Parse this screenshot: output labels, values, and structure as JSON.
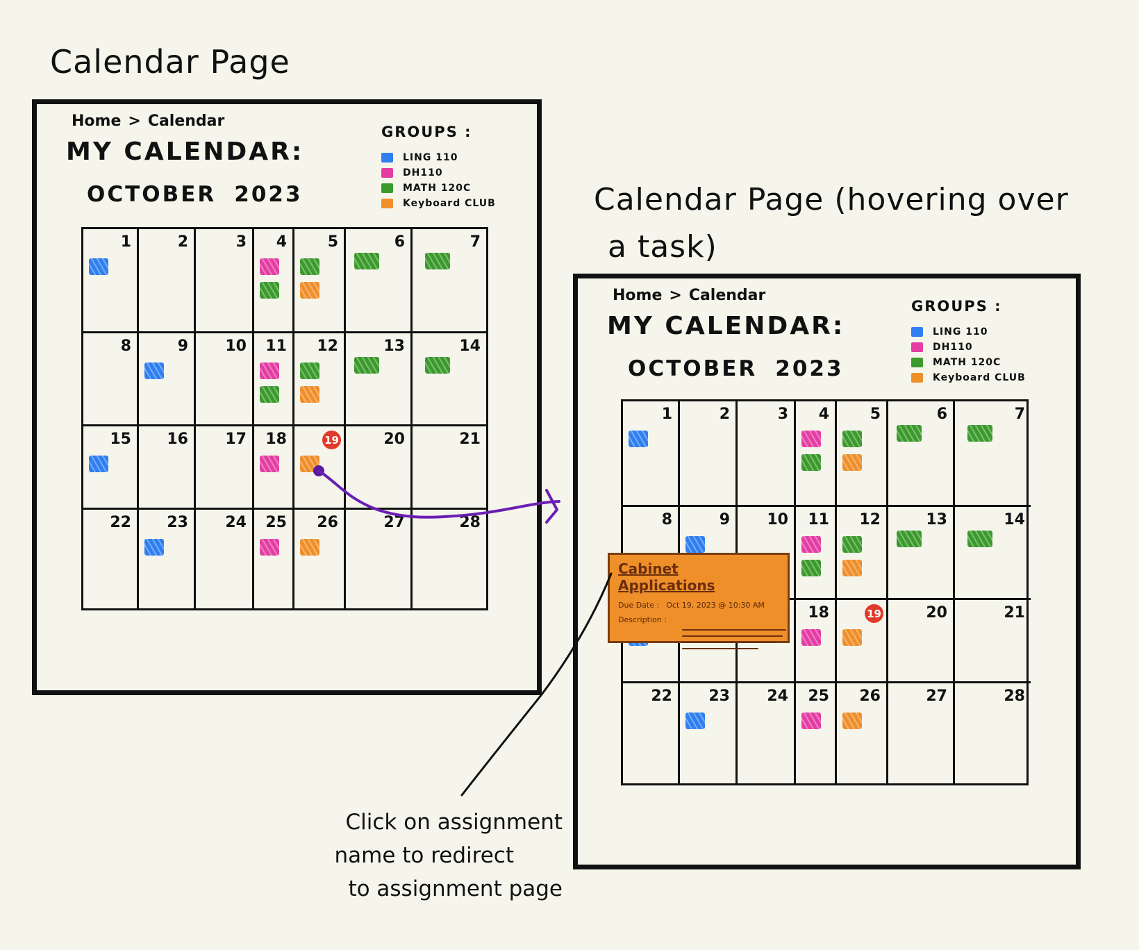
{
  "headings": {
    "left": "Calendar Page",
    "right_line1": "Calendar Page (hovering over",
    "right_line2": "a task)"
  },
  "screen": {
    "breadcrumb": {
      "home": "Home",
      "separator": ">",
      "current": "Calendar"
    },
    "title": "MY CALENDAR:",
    "month": "OCTOBER",
    "year": "2023",
    "groups_heading": "GROUPS :",
    "groups": [
      {
        "label": "LING 110",
        "color": "#2f7ff0"
      },
      {
        "label": "DH110",
        "color": "#e43ea3"
      },
      {
        "label": "MATH 120C",
        "color": "#3b9a2c"
      },
      {
        "label": "Keyboard CLUB",
        "color": "#ef8f2a"
      }
    ],
    "weeks": [
      [
        {
          "day": "1",
          "tasks": [
            "LING 110"
          ]
        },
        {
          "day": "2",
          "tasks": []
        },
        {
          "day": "3",
          "tasks": []
        },
        {
          "day": "4",
          "tasks": [
            "DH110",
            "MATH 120C"
          ]
        },
        {
          "day": "5",
          "tasks": [
            "MATH 120C",
            "Keyboard CLUB"
          ]
        },
        {
          "day": "6",
          "tasks": [
            "MATH 120C"
          ]
        },
        {
          "day": "7",
          "tasks": [
            "MATH 120C"
          ]
        }
      ],
      [
        {
          "day": "8",
          "tasks": []
        },
        {
          "day": "9",
          "tasks": [
            "LING 110"
          ]
        },
        {
          "day": "10",
          "tasks": []
        },
        {
          "day": "11",
          "tasks": [
            "DH110",
            "MATH 120C"
          ]
        },
        {
          "day": "12",
          "tasks": [
            "MATH 120C",
            "Keyboard CLUB"
          ]
        },
        {
          "day": "13",
          "tasks": [
            "MATH 120C"
          ]
        },
        {
          "day": "14",
          "tasks": [
            "MATH 120C"
          ]
        }
      ],
      [
        {
          "day": "15",
          "tasks": [
            "LING 110"
          ]
        },
        {
          "day": "16",
          "tasks": []
        },
        {
          "day": "17",
          "tasks": []
        },
        {
          "day": "18",
          "tasks": [
            "DH110"
          ]
        },
        {
          "day": "19",
          "tasks": [
            "Keyboard CLUB"
          ],
          "today": true
        },
        {
          "day": "20",
          "tasks": []
        },
        {
          "day": "21",
          "tasks": []
        }
      ],
      [
        {
          "day": "22",
          "tasks": []
        },
        {
          "day": "23",
          "tasks": [
            "LING 110"
          ]
        },
        {
          "day": "24",
          "tasks": []
        },
        {
          "day": "25",
          "tasks": [
            "DH110"
          ]
        },
        {
          "day": "26",
          "tasks": [
            "Keyboard CLUB"
          ]
        },
        {
          "day": "27",
          "tasks": []
        },
        {
          "day": "28",
          "tasks": []
        }
      ]
    ]
  },
  "popup": {
    "title": "Cabinet Applications",
    "due_label": "Due Date :",
    "due_value": "Oct 19, 2023 @ 10:30 AM",
    "description_label": "Description :"
  },
  "annotation": {
    "line1": "Click on assignment",
    "line2": "name to redirect",
    "line3": "to assignment page"
  }
}
